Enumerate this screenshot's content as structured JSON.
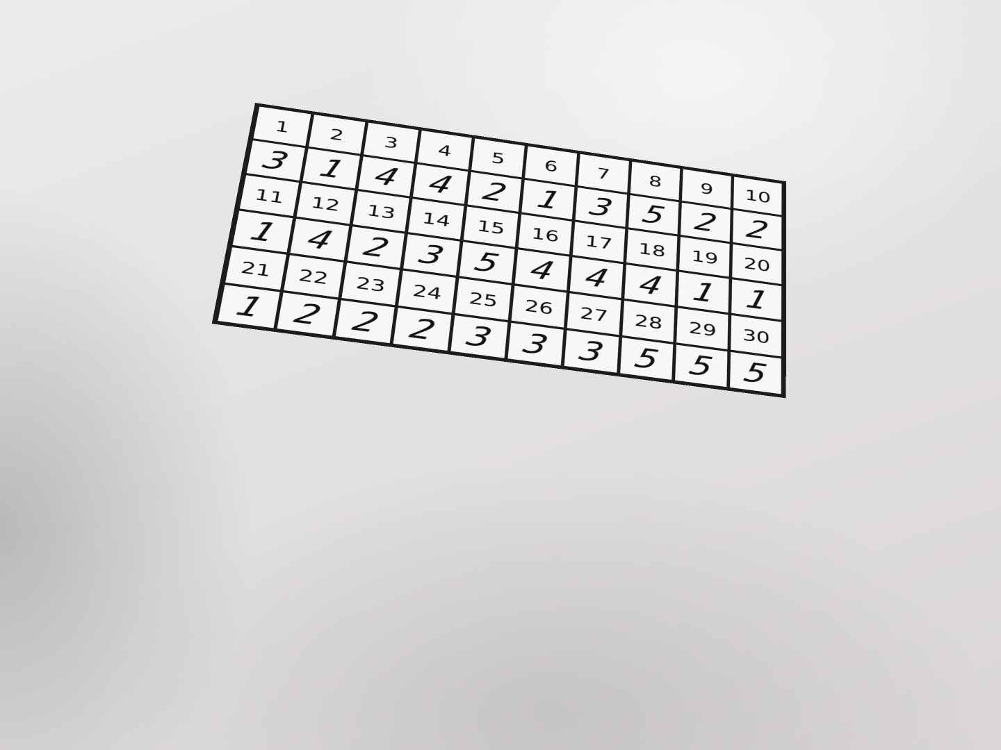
{
  "sheet": {
    "rows": [
      {
        "numbers": [
          "1",
          "2",
          "3",
          "4",
          "5",
          "6",
          "7",
          "8",
          "9",
          "10"
        ],
        "answers": [
          "3",
          "1",
          "4",
          "4",
          "2",
          "1",
          "3",
          "5",
          "2",
          "2"
        ]
      },
      {
        "numbers": [
          "11",
          "12",
          "13",
          "14",
          "15",
          "16",
          "17",
          "18",
          "19",
          "20"
        ],
        "answers": [
          "1",
          "4",
          "2",
          "3",
          "5",
          "4",
          "4",
          "4",
          "1",
          "1"
        ]
      },
      {
        "numbers": [
          "21",
          "22",
          "23",
          "24",
          "25",
          "26",
          "27",
          "28",
          "29",
          "30"
        ],
        "answers": [
          "1",
          "2",
          "2",
          "2",
          "3",
          "3",
          "3",
          "5",
          "5",
          "5"
        ]
      }
    ]
  }
}
